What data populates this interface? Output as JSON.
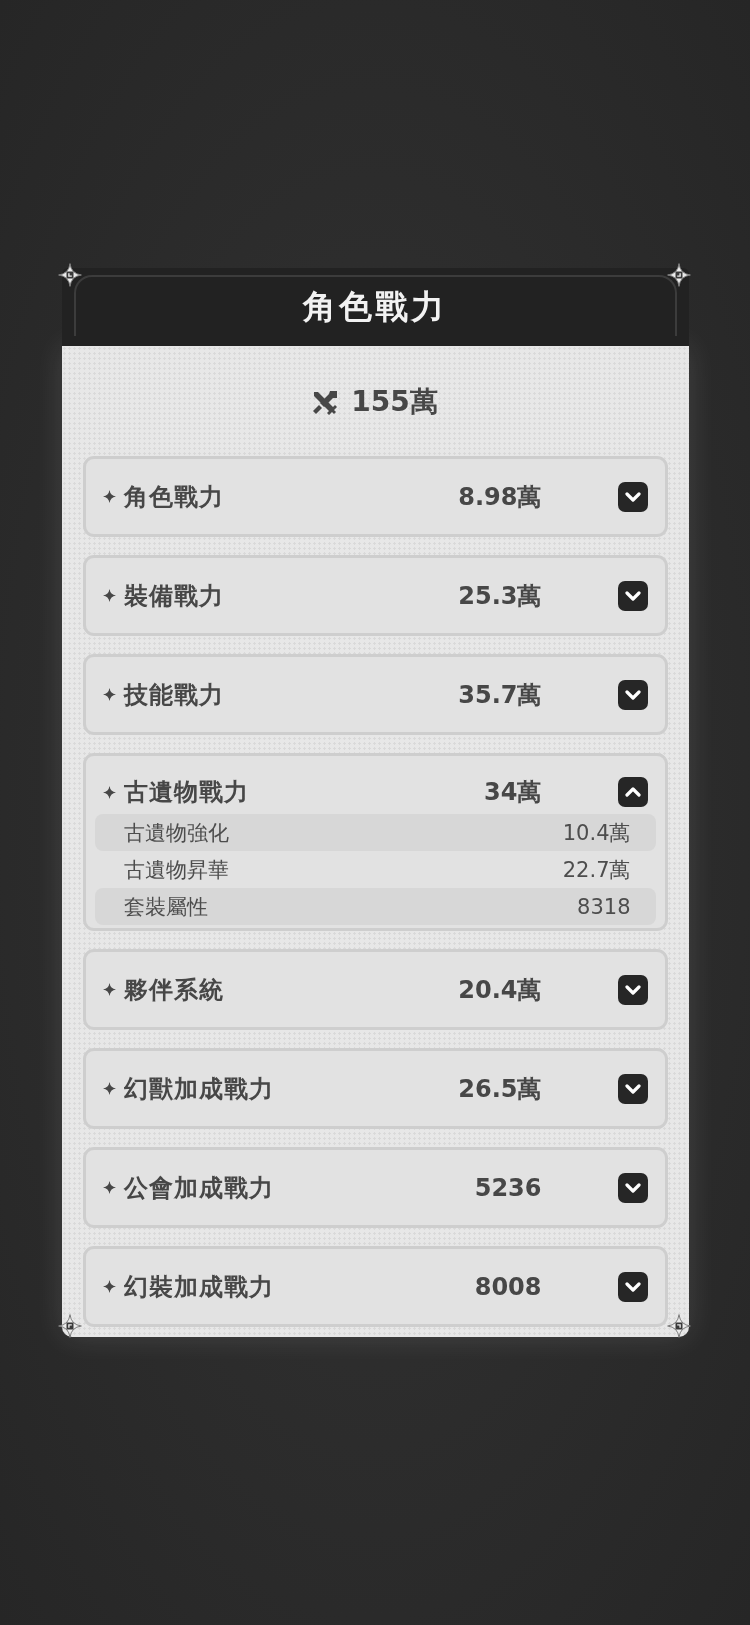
{
  "dialog": {
    "title": "角色戰力",
    "total": "155萬",
    "categories": [
      {
        "label": "角色戰力",
        "value": "8.98萬",
        "expanded": false
      },
      {
        "label": "裝備戰力",
        "value": "25.3萬",
        "expanded": false
      },
      {
        "label": "技能戰力",
        "value": "35.7萬",
        "expanded": false
      },
      {
        "label": "古遺物戰力",
        "value": "34萬",
        "expanded": true,
        "children": [
          {
            "label": "古遺物強化",
            "value": "10.4萬"
          },
          {
            "label": "古遺物昇華",
            "value": "22.7萬"
          },
          {
            "label": "套裝屬性",
            "value": "8318"
          }
        ]
      },
      {
        "label": "夥伴系統",
        "value": "20.4萬",
        "expanded": false
      },
      {
        "label": "幻獸加成戰力",
        "value": "26.5萬",
        "expanded": false
      },
      {
        "label": "公會加成戰力",
        "value": "5236",
        "expanded": false
      },
      {
        "label": "幻裝加成戰力",
        "value": "8008",
        "expanded": false
      }
    ]
  }
}
